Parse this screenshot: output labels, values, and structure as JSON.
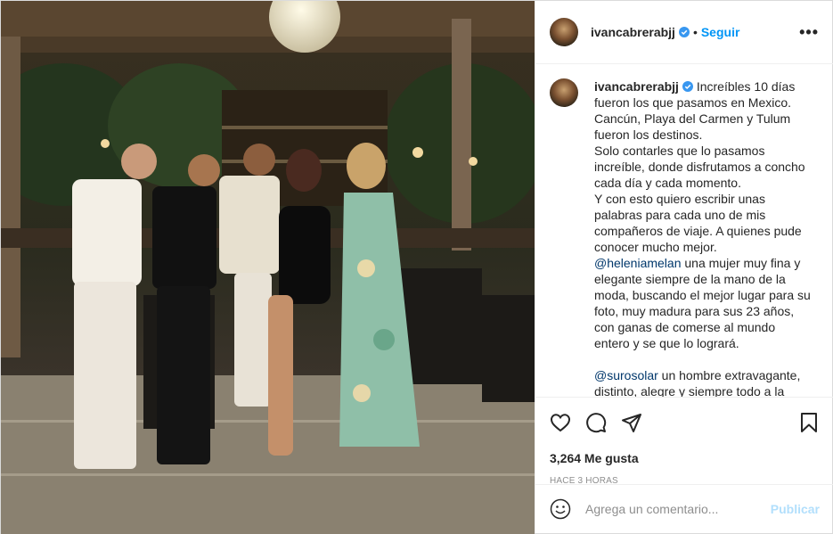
{
  "post": {
    "username": "ivancabrerabjj",
    "follow_label": "Seguir",
    "more_label": "•••",
    "caption_lines": [
      "Increíbles 10 días",
      "fueron los que pasamos en Mexico.",
      "Cancún, Playa del Carmen y Tulum",
      "fueron los destinos.",
      "Solo contarles que lo pasamos",
      "increíble, donde disfrutamos a concho",
      "cada día y cada momento.",
      "Y con esto quiero escribir unas",
      "palabras para cada uno de mis",
      "compañeros de viaje. A quienes pude",
      "conocer mucho mejor."
    ],
    "mention1": "@heleniamelan",
    "mention1_text": " una mujer muy fina y elegante siempre de la mano de la moda, buscando el mejor lugar para su foto, muy madura para sus 23 años, con ganas de comerse al mundo entero y se que lo logrará.",
    "mention2": "@surosolar",
    "mention2_text": " un hombre extravagante, distinto, alegre y siempre todo a la moda",
    "likes": "3,264 Me gusta",
    "time": "HACE 3 HORAS",
    "comment_placeholder": "Agrega un comentario...",
    "publish_label": "Publicar"
  },
  "icons": {
    "like": "heart-icon",
    "comment": "comment-icon",
    "share": "share-icon",
    "save": "bookmark-icon",
    "emoji": "emoji-icon",
    "verified": "verified-badge-icon"
  },
  "colors": {
    "accent": "#0095f6",
    "publish_disabled": "#b2dffc",
    "text": "#262626",
    "muted": "#8e8e8e",
    "mention": "#00376b"
  }
}
